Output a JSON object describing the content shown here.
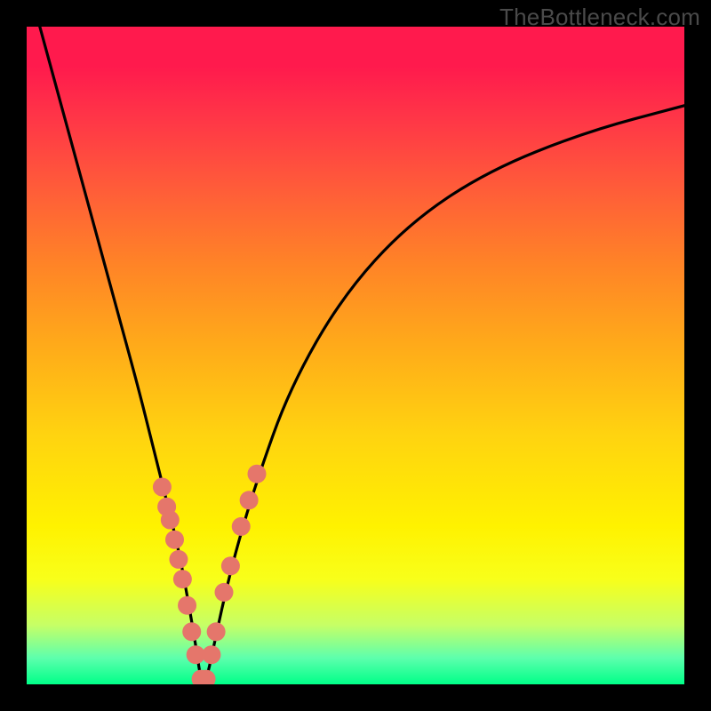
{
  "watermark": "TheBottleneck.com",
  "chart_data": {
    "type": "line",
    "title": "",
    "xlabel": "",
    "ylabel": "",
    "xlim": [
      0,
      100
    ],
    "ylim": [
      0,
      100
    ],
    "series": [
      {
        "name": "bottleneck-curve",
        "x": [
          2,
          5,
          8,
          11,
          14,
          17,
          19,
          21,
          23,
          24.5,
          25.7,
          26.5,
          27.3,
          28.5,
          30,
          32,
          35,
          40,
          48,
          58,
          70,
          85,
          100
        ],
        "y": [
          100,
          89,
          78,
          67,
          56,
          45,
          37,
          29,
          21,
          13,
          6,
          0.5,
          0.5,
          6,
          13,
          21,
          31,
          45,
          59,
          70,
          78,
          84,
          88
        ]
      }
    ],
    "markers": {
      "name": "highlighted-points",
      "color": "#e5766b",
      "x_left": [
        20.6,
        21.3,
        21.8,
        22.5,
        23.1,
        23.7,
        24.4,
        25.1,
        25.7,
        26.5,
        27.3,
        28.1
      ],
      "y_left": [
        30,
        27,
        25,
        22,
        19,
        16,
        12,
        8,
        4.5,
        0.8,
        0.8,
        4.5
      ],
      "x_right": [
        28.8,
        30.0,
        31.0,
        32.6,
        33.8,
        35.0
      ],
      "y_right": [
        8,
        14,
        18,
        24,
        28,
        32
      ]
    },
    "gradient_stops": [
      {
        "pos": 0.0,
        "color": "#ff1a4d"
      },
      {
        "pos": 0.5,
        "color": "#ffb300"
      },
      {
        "pos": 0.8,
        "color": "#fff200"
      },
      {
        "pos": 1.0,
        "color": "#00ff88"
      }
    ]
  }
}
